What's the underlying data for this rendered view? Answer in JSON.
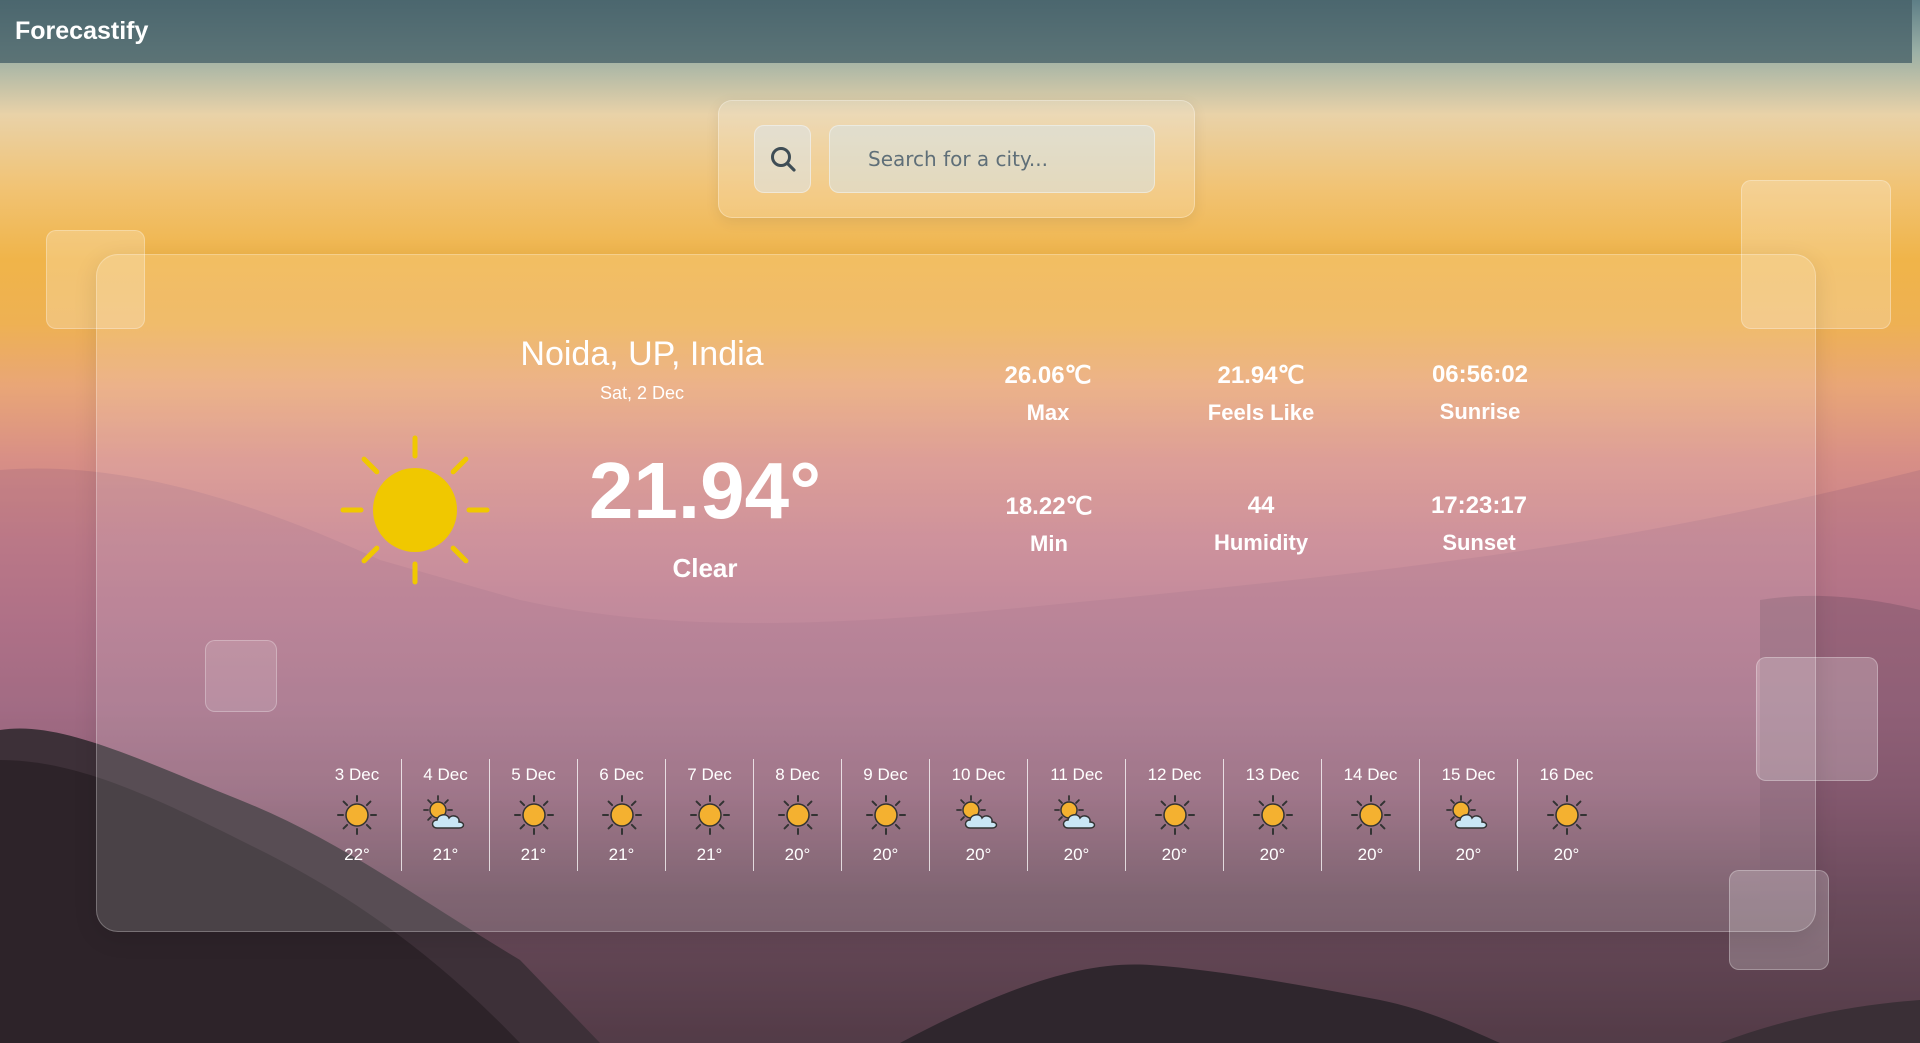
{
  "app": {
    "title": "Forecastify"
  },
  "search": {
    "placeholder": "Search for a city..."
  },
  "current": {
    "location": "Noida, UP, India",
    "date": "Sat, 2 Dec",
    "temperature": "21.94°",
    "condition": "Clear",
    "icon": "sun-icon"
  },
  "stats": {
    "max": {
      "value": "26.06℃",
      "label": "Max"
    },
    "feels_like": {
      "value": "21.94℃",
      "label": "Feels Like"
    },
    "sunrise": {
      "value": "06:56:02",
      "label": "Sunrise"
    },
    "min": {
      "value": "18.22℃",
      "label": "Min"
    },
    "humidity": {
      "value": "44",
      "label": "Humidity"
    },
    "sunset": {
      "value": "17:23:17",
      "label": "Sunset"
    }
  },
  "forecast": [
    {
      "date": "3 Dec",
      "temp": "22°",
      "icon": "sun"
    },
    {
      "date": "4 Dec",
      "temp": "21°",
      "icon": "partly-cloudy"
    },
    {
      "date": "5 Dec",
      "temp": "21°",
      "icon": "sun"
    },
    {
      "date": "6 Dec",
      "temp": "21°",
      "icon": "sun"
    },
    {
      "date": "7 Dec",
      "temp": "21°",
      "icon": "sun"
    },
    {
      "date": "8 Dec",
      "temp": "20°",
      "icon": "sun"
    },
    {
      "date": "9 Dec",
      "temp": "20°",
      "icon": "sun"
    },
    {
      "date": "10 Dec",
      "temp": "20°",
      "icon": "partly-cloudy"
    },
    {
      "date": "11 Dec",
      "temp": "20°",
      "icon": "partly-cloudy"
    },
    {
      "date": "12 Dec",
      "temp": "20°",
      "icon": "sun"
    },
    {
      "date": "13 Dec",
      "temp": "20°",
      "icon": "sun"
    },
    {
      "date": "14 Dec",
      "temp": "20°",
      "icon": "sun"
    },
    {
      "date": "15 Dec",
      "temp": "20°",
      "icon": "partly-cloudy"
    },
    {
      "date": "16 Dec",
      "temp": "20°",
      "icon": "sun"
    }
  ],
  "colors": {
    "sun_big": "#f0c800",
    "sun_small": "#f4b130",
    "cloud": "#c9e6f5",
    "outline": "#333333"
  }
}
